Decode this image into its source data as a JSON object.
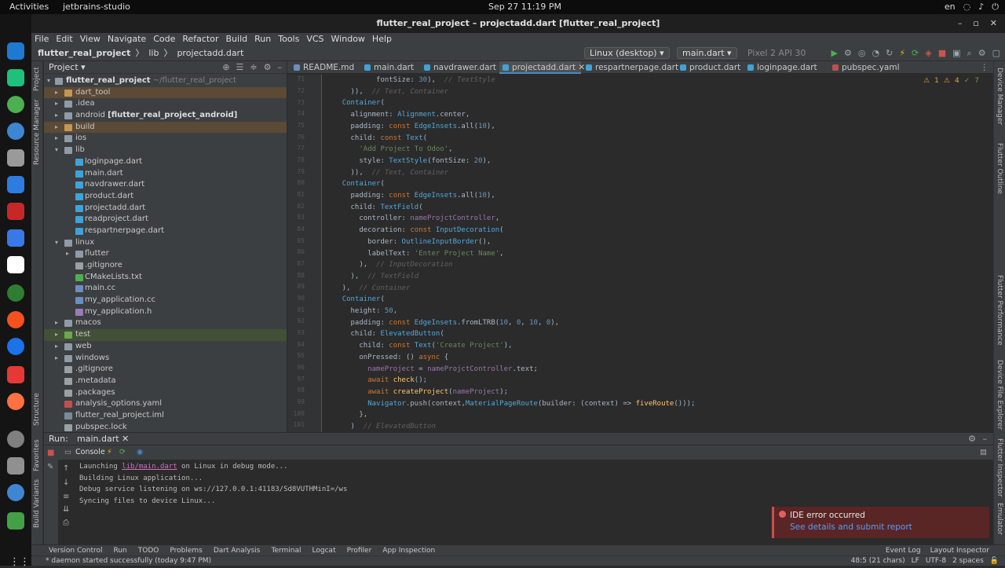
{
  "system": {
    "activities": "Activities",
    "app": "jetbrains-studio",
    "clock": "Sep 27  11:19 PM",
    "lang": "en"
  },
  "window": {
    "title": "flutter_real_project – projectadd.dart [flutter_real_project]"
  },
  "menu": [
    "File",
    "Edit",
    "View",
    "Navigate",
    "Code",
    "Refactor",
    "Build",
    "Run",
    "Tools",
    "VCS",
    "Window",
    "Help"
  ],
  "breadcrumb": {
    "project": "flutter_real_project",
    "dir": "lib",
    "file": "projectadd.dart"
  },
  "toolbar": {
    "device": "Linux (desktop)",
    "config": "main.dart",
    "emulator": "Pixel 2 API 30"
  },
  "project_panel": {
    "title": "Project",
    "root_name": "flutter_real_project",
    "root_path": "~/flutter_real_project",
    "items": [
      {
        "label": "dart_tool",
        "extra": ""
      },
      {
        "label": ".idea",
        "extra": ""
      },
      {
        "label": "android",
        "extra": "[flutter_real_project_android]"
      },
      {
        "label": "build",
        "extra": ""
      },
      {
        "label": "ios",
        "extra": ""
      },
      {
        "label": "lib",
        "extra": ""
      },
      {
        "label": "loginpage.dart",
        "extra": ""
      },
      {
        "label": "main.dart",
        "extra": ""
      },
      {
        "label": "navdrawer.dart",
        "extra": ""
      },
      {
        "label": "product.dart",
        "extra": ""
      },
      {
        "label": "projectadd.dart",
        "extra": ""
      },
      {
        "label": "readproject.dart",
        "extra": ""
      },
      {
        "label": "respartnerpage.dart",
        "extra": ""
      },
      {
        "label": "linux",
        "extra": ""
      },
      {
        "label": "flutter",
        "extra": ""
      },
      {
        "label": ".gitignore",
        "extra": ""
      },
      {
        "label": "CMakeLists.txt",
        "extra": ""
      },
      {
        "label": "main.cc",
        "extra": ""
      },
      {
        "label": "my_application.cc",
        "extra": ""
      },
      {
        "label": "my_application.h",
        "extra": ""
      },
      {
        "label": "macos",
        "extra": ""
      },
      {
        "label": "test",
        "extra": ""
      },
      {
        "label": "web",
        "extra": ""
      },
      {
        "label": "windows",
        "extra": ""
      },
      {
        "label": ".gitignore",
        "extra": ""
      },
      {
        "label": ".metadata",
        "extra": ""
      },
      {
        "label": ".packages",
        "extra": ""
      },
      {
        "label": "analysis_options.yaml",
        "extra": ""
      },
      {
        "label": "flutter_real_project.iml",
        "extra": ""
      },
      {
        "label": "pubspec.lock",
        "extra": ""
      }
    ]
  },
  "tabs": [
    "README.md",
    "main.dart",
    "navdrawer.dart",
    "projectadd.dart",
    "respartnerpage.dart",
    "product.dart",
    "loginpage.dart",
    "pubspec.yaml"
  ],
  "inspections": {
    "warn": "1",
    "weak": "4",
    "typo": "7"
  },
  "code_lines": [
    "            fontSize: 30),  // TextStyle",
    "      )),  // Text, Container",
    "    Container(",
    "      alignment: Alignment.center,",
    "      padding: const EdgeInsets.all(10),",
    "      child: const Text(",
    "        'Add Project To Odoo',",
    "        style: TextStyle(fontSize: 20),",
    "      )),  // Text, Container",
    "    Container(",
    "      padding: const EdgeInsets.all(10),",
    "      child: TextField(",
    "        controller: nameProjctController,",
    "        decoration: const InputDecoration(",
    "          border: OutlineInputBorder(),",
    "          labelText: 'Enter Project Name',",
    "        ),  // InputDecoration",
    "      ),  // TextField",
    "    ),  // Container",
    "    Container(",
    "      height: 50,",
    "      padding: const EdgeInsets.fromLTRB(10, 0, 10, 0),",
    "      child: ElevatedButton(",
    "        child: const Text('Create Project'),",
    "        onPressed: () async {",
    "          nameProject = nameProjctController.text;",
    "          await check();",
    "          await createProject(nameProject);",
    "          Navigator.push(context,MaterialPageRoute(builder: (context) => fiveRoute()));",
    "        },",
    "      )  // ElevatedButton"
  ],
  "line_numbers": [
    "71",
    "72",
    "73",
    "74",
    "75",
    "76",
    "77",
    "78",
    "79",
    "80",
    "81",
    "82",
    "83",
    "84",
    "85",
    "86",
    "87",
    "88",
    "89",
    "90",
    "91",
    "92",
    "93",
    "94",
    "95",
    "96",
    "97",
    "98",
    "99",
    "100",
    "101"
  ],
  "run_panel": {
    "label": "Run:",
    "tab": "main.dart",
    "console_tab": "Console"
  },
  "console": {
    "l1_pre": "Launching ",
    "l1_link": "lib/main.dart",
    "l1_post": " on Linux in debug mode...",
    "l2": "Building Linux application...",
    "l3": "Debug service listening on ws://127.0.0.1:41183/Sd8VUTHMinI=/ws",
    "l4": "Syncing files to device Linux..."
  },
  "notification": {
    "title": "IDE error occurred",
    "link": "See details and submit report"
  },
  "bottom_tools": [
    "Version Control",
    "Run",
    "TODO",
    "Problems",
    "Dart Analysis",
    "Terminal",
    "Logcat",
    "Profiler",
    "App Inspection"
  ],
  "bottom_right": [
    "Event Log",
    "Layout Inspector"
  ],
  "status": {
    "message": "* daemon started successfully (today 9:47 PM)",
    "position": "48:5 (21 chars)",
    "eol": "LF",
    "encoding": "UTF-8",
    "indent": "2 spaces"
  },
  "side_left": [
    "Project",
    "Resource Manager",
    "Structure",
    "Favorites",
    "Build Variants"
  ],
  "side_right": [
    "Device Manager",
    "Flutter Outline",
    "Flutter Performance",
    "Device File Explorer",
    "Flutter Inspector",
    "Emulator"
  ],
  "colors": {
    "accent": "#4a88c7",
    "error": "#c94f4f",
    "keyword": "#cc7832",
    "string": "#6a8759",
    "number": "#6897bb"
  }
}
